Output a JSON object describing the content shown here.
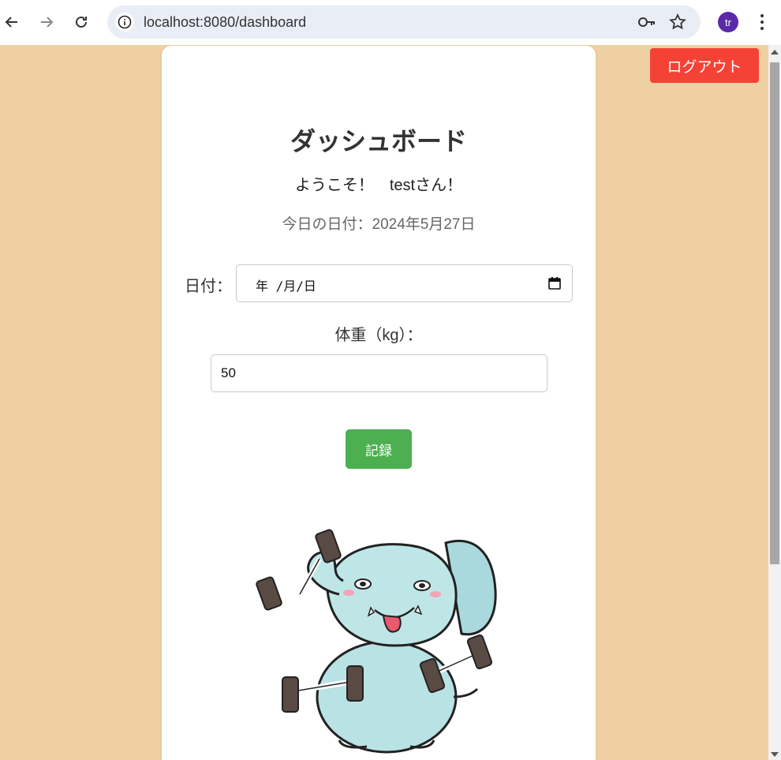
{
  "browser": {
    "url": "localhost:8080/dashboard",
    "avatar_initials": "tr"
  },
  "header": {
    "logout_label": "ログアウト"
  },
  "main": {
    "title": "ダッシュボード",
    "welcome": "ようこそ！　testさん！",
    "today": "今日の日付：2024年5月27日"
  },
  "form": {
    "date_label": "日付：",
    "date_value": "年 /月/日",
    "weight_label": "体重（kg）：",
    "weight_value": "50",
    "submit_label": "記録"
  },
  "colors": {
    "background": "#efd0a2",
    "logout": "#f44336",
    "submit": "#4caf50",
    "avatar": "#5b2aa8"
  },
  "mascot": {
    "icon": "elephant-lifting-dumbbells-illustration"
  }
}
